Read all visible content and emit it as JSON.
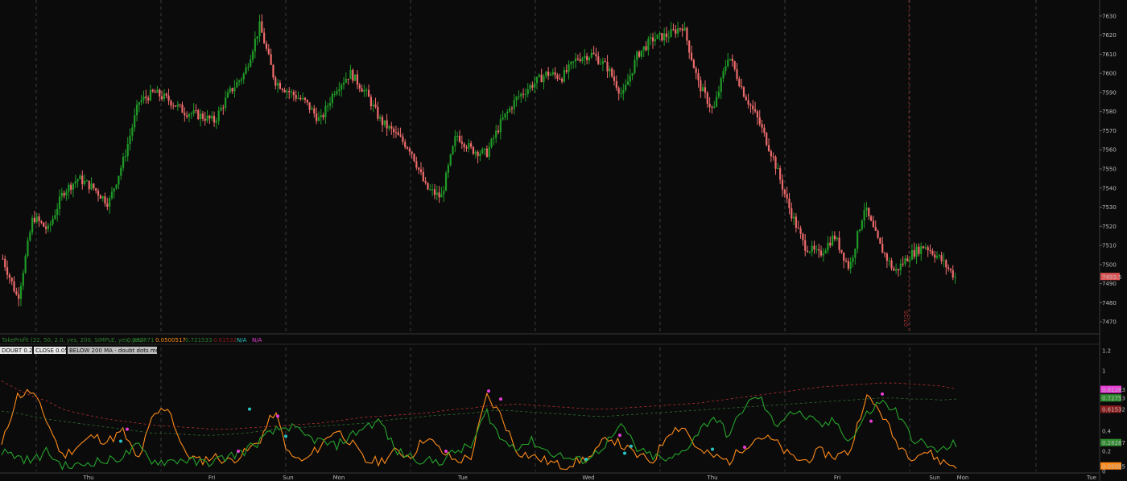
{
  "chart_data": [
    {
      "type": "candlestick",
      "panel": "price",
      "y_ticks": [
        7630,
        7620,
        7610,
        7600,
        7590,
        7580,
        7570,
        7560,
        7550,
        7540,
        7530,
        7520,
        7510,
        7500,
        7490,
        7480,
        7470
      ],
      "ylim": [
        7465,
        7635
      ],
      "current_price_label": "7493.5",
      "current_price": 7493.5,
      "vertical_marker_label": "07/26",
      "x_day_labels": [
        "Thu",
        "Fri",
        "Sun",
        "Mon",
        "Tue",
        "Wed",
        "Thu",
        "Fri",
        "Sun",
        "Mon",
        "Tue"
      ],
      "approx_close_path": [
        7503,
        7482,
        7525,
        7518,
        7538,
        7545,
        7540,
        7532,
        7555,
        7585,
        7590,
        7586,
        7580,
        7578,
        7575,
        7590,
        7600,
        7625,
        7596,
        7590,
        7585,
        7575,
        7592,
        7600,
        7590,
        7575,
        7568,
        7560,
        7540,
        7535,
        7568,
        7560,
        7558,
        7575,
        7587,
        7594,
        7600,
        7598,
        7608,
        7610,
        7603,
        7588,
        7610,
        7618,
        7620,
        7625,
        7595,
        7580,
        7610,
        7590,
        7575,
        7555,
        7530,
        7510,
        7505,
        7515,
        7498,
        7530,
        7510,
        7496,
        7505,
        7510,
        7503,
        7493.5
      ],
      "colors": {
        "up": "#1f9a27",
        "down": "#ee6b6b",
        "background": "#0b0b0b"
      }
    },
    {
      "type": "line",
      "panel": "oscillator",
      "study_title": "TakeProfit (22, 50, 2.0, yes, 200, SIMPLE, yes, yes)",
      "study_values": [
        "0.282871",
        "0.0500517",
        "0.721533",
        "0.61532",
        "N/A",
        "N/A"
      ],
      "badges": [
        "DOUBT 0.28",
        "CLOSE 0.05",
        "BELOW 200 MA - doubt dots muted"
      ],
      "y_ticks": [
        "1.2",
        "1",
        "0.8",
        "0.6",
        "0.4",
        "0.2",
        "0"
      ],
      "ylim": [
        0,
        1.25
      ],
      "series": [
        {
          "name": "",
          "color": "#ff8c1a",
          "values": [
            0.25,
            0.75,
            0.8,
            0.5,
            0.15,
            0.25,
            0.35,
            0.3,
            0.4,
            0.1,
            0.55,
            0.65,
            0.2,
            0.1,
            0.15,
            0.1,
            0.18,
            0.3,
            0.6,
            0.15,
            0.1,
            0.25,
            0.42,
            0.3,
            0.1,
            0.1,
            0.2,
            0.15,
            0.35,
            0.2,
            0.1,
            0.15,
            0.75,
            0.55,
            0.2,
            0.15,
            0.1,
            0.05,
            0.1,
            0.15,
            0.35,
            0.25,
            0.15,
            0.1,
            0.4,
            0.45,
            0.2,
            0.15,
            0.1,
            0.25,
            0.35,
            0.3,
            0.15,
            0.1,
            0.2,
            0.15,
            0.2,
            0.75,
            0.6,
            0.3,
            0.15,
            0.2,
            0.1,
            0.05
          ]
        },
        {
          "name": "",
          "color": "#26a32b",
          "values": [
            0.2,
            0.15,
            0.1,
            0.2,
            0.05,
            0.05,
            0.1,
            0.1,
            0.15,
            0.25,
            0.1,
            0.1,
            0.12,
            0.08,
            0.1,
            0.15,
            0.2,
            0.3,
            0.4,
            0.45,
            0.35,
            0.3,
            0.25,
            0.35,
            0.45,
            0.5,
            0.2,
            0.15,
            0.1,
            0.1,
            0.2,
            0.25,
            0.6,
            0.3,
            0.25,
            0.3,
            0.2,
            0.15,
            0.1,
            0.15,
            0.3,
            0.45,
            0.2,
            0.15,
            0.1,
            0.2,
            0.4,
            0.55,
            0.35,
            0.65,
            0.75,
            0.45,
            0.6,
            0.55,
            0.45,
            0.5,
            0.3,
            0.55,
            0.7,
            0.6,
            0.35,
            0.25,
            0.2,
            0.28
          ]
        },
        {
          "name": "",
          "color": "#b33030",
          "dashed": true,
          "values": [
            0.9,
            0.82,
            0.75,
            0.7,
            0.62,
            0.58,
            0.55,
            0.52,
            0.5,
            0.48,
            0.46,
            0.45,
            0.44,
            0.43,
            0.42,
            0.42,
            0.43,
            0.44,
            0.45,
            0.46,
            0.47,
            0.48,
            0.5,
            0.52,
            0.54,
            0.55,
            0.56,
            0.57,
            0.58,
            0.6,
            0.62,
            0.63,
            0.65,
            0.66,
            0.67,
            0.66,
            0.65,
            0.64,
            0.63,
            0.62,
            0.62,
            0.63,
            0.64,
            0.65,
            0.66,
            0.67,
            0.68,
            0.7,
            0.72,
            0.74,
            0.76,
            0.78,
            0.8,
            0.82,
            0.84,
            0.85,
            0.86,
            0.87,
            0.88,
            0.88,
            0.87,
            0.86,
            0.85,
            0.82
          ]
        },
        {
          "name": "",
          "color": "#2f6f2f",
          "dashed": true,
          "values": [
            0.6,
            0.58,
            0.55,
            0.52,
            0.5,
            0.48,
            0.46,
            0.44,
            0.42,
            0.4,
            0.38,
            0.38,
            0.37,
            0.36,
            0.36,
            0.37,
            0.38,
            0.4,
            0.42,
            0.43,
            0.44,
            0.45,
            0.46,
            0.47,
            0.48,
            0.5,
            0.52,
            0.53,
            0.55,
            0.56,
            0.57,
            0.58,
            0.6,
            0.61,
            0.6,
            0.59,
            0.58,
            0.57,
            0.56,
            0.55,
            0.55,
            0.56,
            0.57,
            0.58,
            0.59,
            0.6,
            0.61,
            0.62,
            0.63,
            0.64,
            0.65,
            0.66,
            0.67,
            0.68,
            0.69,
            0.7,
            0.71,
            0.72,
            0.73,
            0.73,
            0.72,
            0.72,
            0.71,
            0.72
          ]
        }
      ],
      "value_labels": [
        {
          "text": "0.81283",
          "value": 0.81283,
          "color": "#e83ed6"
        },
        {
          "text": "0.72753",
          "value": 0.72753,
          "color": "#2e8b2e"
        },
        {
          "text": "0.61532",
          "value": 0.61532,
          "color": "#8b1d1d"
        },
        {
          "text": "0.28287",
          "value": 0.28287,
          "color": "#2e8b2e"
        },
        {
          "text": "0.05005",
          "value": 0.05005,
          "color": "#ff8c1a"
        }
      ]
    }
  ]
}
